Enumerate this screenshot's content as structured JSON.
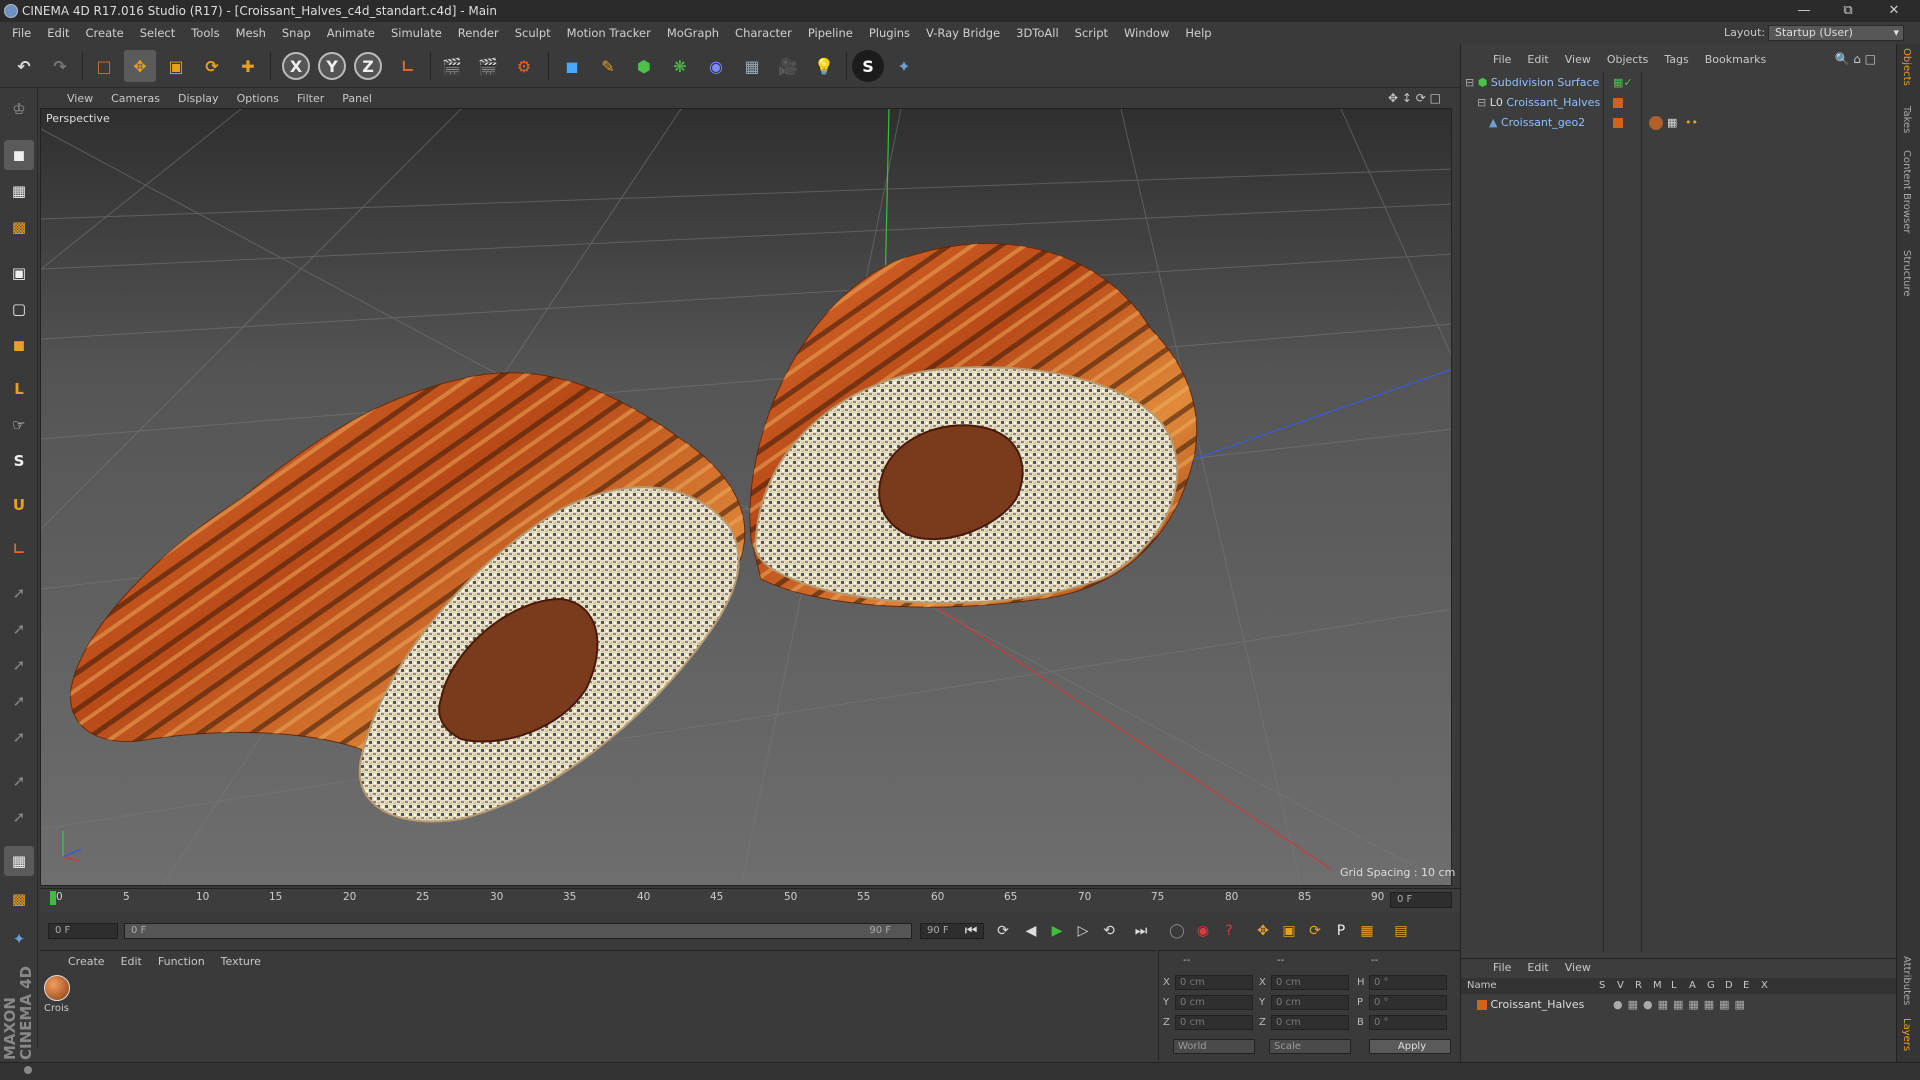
{
  "window": {
    "title": "CINEMA 4D R17.016 Studio (R17) - [Croissant_Halves_c4d_standart.c4d] - Main"
  },
  "menus": [
    "File",
    "Edit",
    "Create",
    "Select",
    "Tools",
    "Mesh",
    "Snap",
    "Animate",
    "Simulate",
    "Render",
    "Sculpt",
    "Motion Tracker",
    "MoGraph",
    "Character",
    "Pipeline",
    "Plugins",
    "V-Ray Bridge",
    "3DToAll",
    "Script",
    "Window",
    "Help"
  ],
  "layout": {
    "label": "Layout:",
    "value": "Startup (User)"
  },
  "viewport": {
    "menus": [
      "View",
      "Cameras",
      "Display",
      "Options",
      "Filter",
      "Panel"
    ],
    "camera": "Perspective",
    "grid_spacing": "Grid Spacing : 10 cm"
  },
  "timeline": {
    "ticks": [
      "0",
      "5",
      "10",
      "15",
      "20",
      "25",
      "30",
      "35",
      "40",
      "45",
      "50",
      "55",
      "60",
      "65",
      "70",
      "75",
      "80",
      "85",
      "90"
    ],
    "current_frame": "0 F",
    "start_field": "0 F",
    "range_start": "0 F",
    "range_end": "90 F",
    "end_field": "90 F"
  },
  "material_manager": {
    "menus": [
      "Create",
      "Edit",
      "Function",
      "Texture"
    ],
    "material_label": "Crois"
  },
  "coordinates": {
    "header": [
      "--",
      "--",
      "--"
    ],
    "rows": [
      {
        "a": "X",
        "av": "0 cm",
        "b": "X",
        "bv": "0 cm",
        "c": "H",
        "cv": "0 °"
      },
      {
        "a": "Y",
        "av": "0 cm",
        "b": "Y",
        "bv": "0 cm",
        "c": "P",
        "cv": "0 °"
      },
      {
        "a": "Z",
        "av": "0 cm",
        "b": "Z",
        "bv": "0 cm",
        "c": "B",
        "cv": "0 °"
      }
    ],
    "space": "World",
    "mode": "Scale",
    "apply": "Apply"
  },
  "object_manager": {
    "menus": [
      "File",
      "Edit",
      "View",
      "Objects",
      "Tags",
      "Bookmarks"
    ],
    "objects": [
      "Subdivision Surface",
      "Croissant_Halves",
      "Croissant_geo2"
    ]
  },
  "layer_manager": {
    "menus": [
      "File",
      "Edit",
      "View"
    ],
    "columns": [
      "Name",
      "S",
      "V",
      "R",
      "M",
      "L",
      "A",
      "G",
      "D",
      "E",
      "X"
    ],
    "layers": [
      "Croissant_Halves"
    ]
  },
  "side_tabs": [
    "Objects",
    "Takes",
    "Content Browser",
    "Structure",
    "Attributes",
    "Layers"
  ],
  "brand": "MAXON CINEMA 4D",
  "colors": {
    "accent": "#e8a020",
    "selection": "#8fc0ff",
    "layer_color": "#d4601a"
  }
}
